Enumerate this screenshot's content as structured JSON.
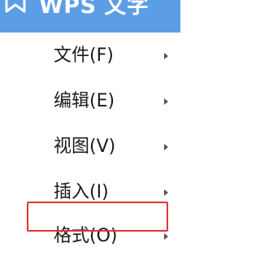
{
  "app": {
    "title": "WPS 文字",
    "icon": "wps-writer-icon",
    "accent_color": "#5b9ee6"
  },
  "menu": {
    "items": [
      {
        "label": "文件(F)",
        "has_submenu": true
      },
      {
        "label": "编辑(E)",
        "has_submenu": true
      },
      {
        "label": "视图(V)",
        "has_submenu": true
      },
      {
        "label": "插入(I)",
        "has_submenu": true
      },
      {
        "label": "格式(O)",
        "has_submenu": true,
        "highlighted": true
      }
    ],
    "submenu_icon": "chevron-right-icon",
    "highlight_color": "#e53333"
  }
}
